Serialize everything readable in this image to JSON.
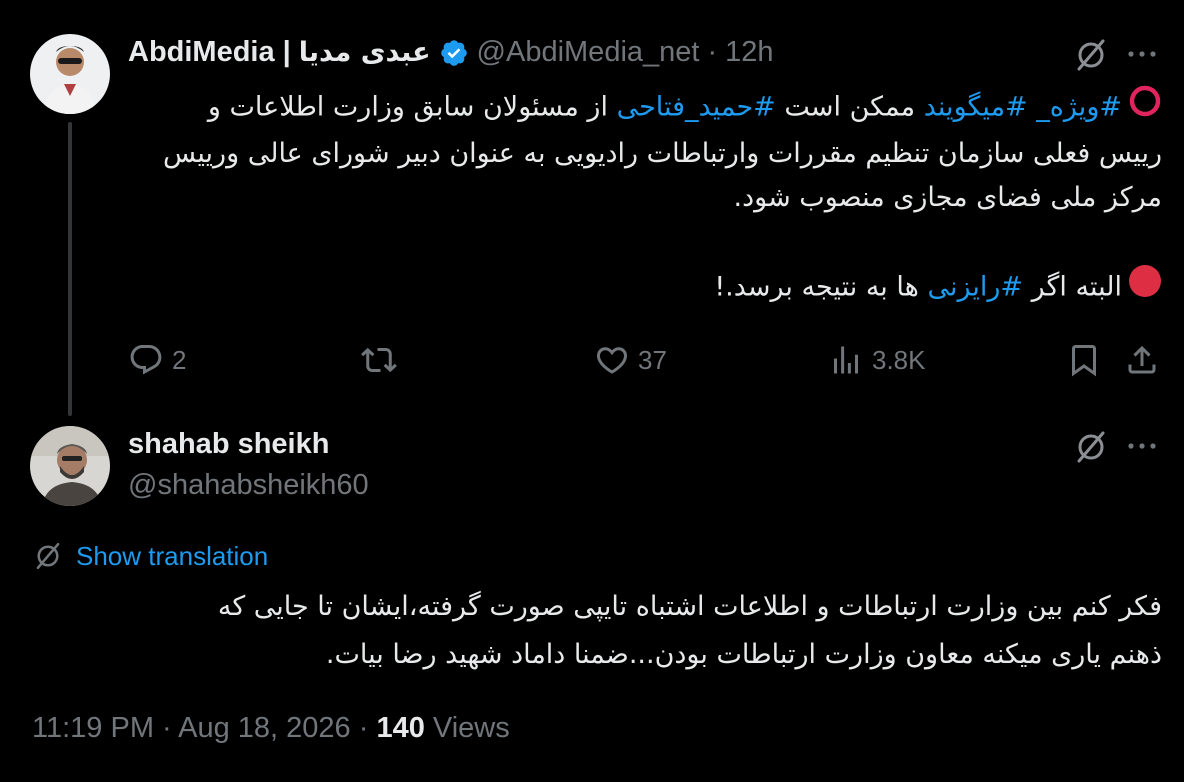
{
  "post": {
    "display_name_en": "AbdiMedia",
    "display_name_sep": "|",
    "display_name_fa": "عبدی مدیا",
    "handle": "@AbdiMedia_net",
    "time_sep": "·",
    "time": "12h",
    "line1_hash1": "#ویژه_",
    "line1_hash2": "#میگویند",
    "line1_text1": "ممکن است",
    "line1_hash3": "#حمید_فتاحی",
    "line1_text2": "از مسئولان سابق وزارت اطلاعات و",
    "line2": "رییس فعلی سازمان تنظیم مقررات وارتباطات رادیویی به عنوان دبیر شورای عالی ورییس",
    "line3": "مرکز ملی فضای مجازی منصوب شود.",
    "line4_text1": "البته اگر",
    "line4_hash": "#رایزنی",
    "line4_text2": "ها به نتیجه برسد.!",
    "stats": {
      "replies": "2",
      "likes": "37",
      "views": "3.8K"
    }
  },
  "reply": {
    "display_name": "shahab sheikh",
    "handle": "@shahabsheikh60",
    "show_translation": "Show translation",
    "line1": "فکر کنم بین وزارت ارتباطات و اطلاعات اشتباه تایپی صورت گرفته،ایشان تا جایی که",
    "line2": "ذهنم یاری میکنه معاون وزارت ارتباطات بودن...ضمنا داماد شهید رضا بیات."
  },
  "footer": {
    "timestamp": "11:19 PM · Aug 18, 2026 ·",
    "views_count": "140",
    "views_label": "Views"
  },
  "icons": {
    "verified": "verified-badge-icon",
    "grok": "grok-icon",
    "more": "more-icon",
    "reply": "reply-icon",
    "retweet": "retweet-icon",
    "like": "like-icon",
    "views": "views-icon",
    "bookmark": "bookmark-icon",
    "share": "share-icon"
  },
  "colors": {
    "accent": "#1d9bf0",
    "text": "#e7e9ea",
    "muted": "#71767b",
    "emoji_red": "#e0245e"
  }
}
